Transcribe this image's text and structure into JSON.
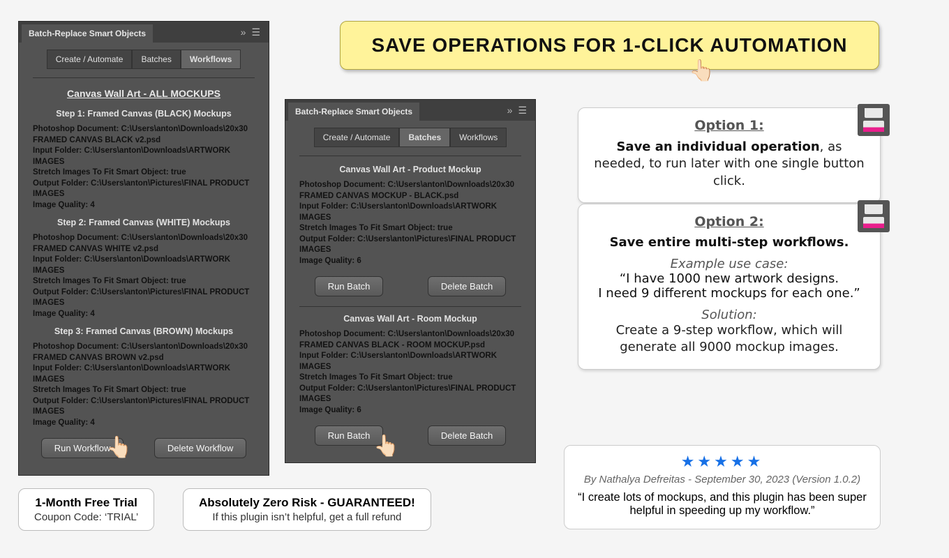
{
  "banner": {
    "text": "SAVE OPERATIONS FOR 1-CLICK AUTOMATION"
  },
  "panelA": {
    "title": "Batch-Replace Smart Objects",
    "tabs": [
      "Create / Automate",
      "Batches",
      "Workflows"
    ],
    "activeTab": 2,
    "workflowTitle": "Canvas Wall Art - ALL MOCKUPS",
    "steps": [
      {
        "title": "Step 1: Framed Canvas (BLACK) Mockups",
        "details": "Photoshop Document: C:\\Users\\anton\\Downloads\\20x30 FRAMED CANVAS BLACK v2.psd\nInput Folder: C:\\Users\\anton\\Downloads\\ARTWORK IMAGES\n Stretch Images To Fit Smart Object: true\nOutput Folder: C:\\Users\\anton\\Pictures\\FINAL PRODUCT IMAGES\nImage Quality: 4"
      },
      {
        "title": "Step 2: Framed Canvas (WHITE) Mockups",
        "details": "Photoshop Document: C:\\Users\\anton\\Downloads\\20x30 FRAMED CANVAS WHITE v2.psd\nInput Folder: C:\\Users\\anton\\Downloads\\ARTWORK IMAGES\n Stretch Images To Fit Smart Object: true\nOutput Folder: C:\\Users\\anton\\Pictures\\FINAL PRODUCT IMAGES\nImage Quality: 4"
      },
      {
        "title": "Step 3: Framed Canvas (BROWN) Mockups",
        "details": "Photoshop Document: C:\\Users\\anton\\Downloads\\20x30 FRAMED CANVAS BROWN v2.psd\nInput Folder: C:\\Users\\anton\\Downloads\\ARTWORK IMAGES\n Stretch Images To Fit Smart Object: true\nOutput Folder: C:\\Users\\anton\\Pictures\\FINAL PRODUCT IMAGES\nImage Quality: 4"
      }
    ],
    "buttons": {
      "run": "Run Workflow",
      "del": "Delete Workflow"
    }
  },
  "panelB": {
    "title": "Batch-Replace Smart Objects",
    "tabs": [
      "Create / Automate",
      "Batches",
      "Workflows"
    ],
    "activeTab": 1,
    "batches": [
      {
        "title": "Canvas Wall Art - Product Mockup",
        "details": "Photoshop Document: C:\\Users\\anton\\Downloads\\20x30 FRAMED CANVAS MOCKUP - BLACK.psd\nInput Folder: C:\\Users\\anton\\Downloads\\ARTWORK IMAGES\n Stretch Images To Fit Smart Object: true\nOutput Folder: C:\\Users\\anton\\Pictures\\FINAL PRODUCT IMAGES\nImage Quality: 6"
      },
      {
        "title": "Canvas Wall Art - Room Mockup",
        "details": "Photoshop Document: C:\\Users\\anton\\Downloads\\20x30 FRAMED CANVAS BLACK - ROOM MOCKUP.psd\nInput Folder: C:\\Users\\anton\\Downloads\\ARTWORK IMAGES\n Stretch Images To Fit Smart Object: true\nOutput Folder: C:\\Users\\anton\\Pictures\\FINAL PRODUCT IMAGES\nImage Quality: 6"
      }
    ],
    "buttons": {
      "run": "Run Batch",
      "del": "Delete Batch"
    }
  },
  "option1": {
    "heading": "Option 1:",
    "line1_bold": "Save an individual operation",
    "line1_rest": ", as needed, to run later with one single button click."
  },
  "option2": {
    "heading": "Option 2:",
    "headline": "Save entire multi-step workflows.",
    "exhead": "Example use case:",
    "example": "“I have 1000 new artwork designs.\nI need 9 different mockups for each one.”",
    "solhead": "Solution:",
    "solution": "Create a 9-step workflow, which will generate all 9000 mockup images."
  },
  "review": {
    "stars": "★★★★★",
    "byline": "By Nathalya Defreitas - September 30, 2023 (Version 1.0.2)",
    "text": "“I create lots of mockups, and this plugin has been super helpful in speeding up my workflow.”"
  },
  "trial1": {
    "t1": "1-Month Free Trial",
    "t2": "Coupon Code: ‘TRIAL’"
  },
  "trial2": {
    "t1": "Absolutely Zero Risk - GUARANTEED!",
    "t2": "If this plugin isn’t helpful, get a full refund"
  }
}
